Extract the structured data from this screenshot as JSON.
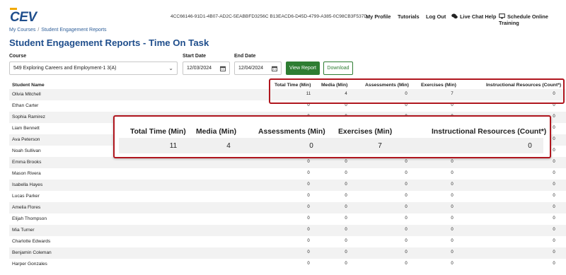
{
  "header": {
    "logo": "CEV",
    "session_id": "4CC66146-91D1-4B07-AD2C-5EABBFD3256C B13EACD6-D45D-4799-A385-0C98CB3F537D",
    "nav": {
      "my_profile": "My Profile",
      "tutorials": "Tutorials",
      "log_out": "Log Out",
      "live_chat": "Live Chat Help",
      "schedule": "Schedule Online Training"
    }
  },
  "breadcrumb": {
    "parent": "My Courses",
    "separator": "/",
    "current": "Student Engagement Reports"
  },
  "page": {
    "title": "Student Engagement Reports - Time On Task"
  },
  "filters": {
    "course_label": "Course",
    "course_value": "549 Exploring Careers and Employment-1 3(A)",
    "start_label": "Start Date",
    "start_value": "12/03/2024",
    "end_label": "End Date",
    "end_value": "12/04/2024",
    "view_report": "View Report",
    "download": "Download"
  },
  "table": {
    "columns": {
      "student": "Student Name",
      "total": "Total Time (Min)",
      "media": "Media (Min)",
      "assessments": "Assessments (Min)",
      "exercises": "Exercises (Min)",
      "resources": "Instructional Resources (Count*)"
    },
    "rows": [
      {
        "name": "Olivia Mitchell",
        "total": "11",
        "media": "4",
        "assessments": "0",
        "exercises": "7",
        "resources": "0"
      },
      {
        "name": "Ethan Carter",
        "total": "0",
        "media": "0",
        "assessments": "0",
        "exercises": "0",
        "resources": "0"
      },
      {
        "name": "Sophia Ramirez",
        "total": "0",
        "media": "0",
        "assessments": "0",
        "exercises": "0",
        "resources": "0"
      },
      {
        "name": "Liam Bennett",
        "total": "0",
        "media": "0",
        "assessments": "0",
        "exercises": "0",
        "resources": "0"
      },
      {
        "name": "Ava Peterson",
        "total": "0",
        "media": "0",
        "assessments": "0",
        "exercises": "0",
        "resources": "0"
      },
      {
        "name": "Noah Sullivan",
        "total": "0",
        "media": "0",
        "assessments": "0",
        "exercises": "0",
        "resources": "0"
      },
      {
        "name": "Emma Brooks",
        "total": "0",
        "media": "0",
        "assessments": "0",
        "exercises": "0",
        "resources": "0"
      },
      {
        "name": "Mason Rivera",
        "total": "0",
        "media": "0",
        "assessments": "0",
        "exercises": "0",
        "resources": "0"
      },
      {
        "name": "Isabella Hayes",
        "total": "0",
        "media": "0",
        "assessments": "0",
        "exercises": "0",
        "resources": "0"
      },
      {
        "name": "Lucas Parker",
        "total": "0",
        "media": "0",
        "assessments": "0",
        "exercises": "0",
        "resources": "0"
      },
      {
        "name": "Amelia Flores",
        "total": "0",
        "media": "0",
        "assessments": "0",
        "exercises": "0",
        "resources": "0"
      },
      {
        "name": "Elijah Thompson",
        "total": "0",
        "media": "0",
        "assessments": "0",
        "exercises": "0",
        "resources": "0"
      },
      {
        "name": "Mia Turner",
        "total": "0",
        "media": "0",
        "assessments": "0",
        "exercises": "0",
        "resources": "0"
      },
      {
        "name": "Charlotte Edwards",
        "total": "0",
        "media": "0",
        "assessments": "0",
        "exercises": "0",
        "resources": "0"
      },
      {
        "name": "Benjamin Coleman",
        "total": "0",
        "media": "0",
        "assessments": "0",
        "exercises": "0",
        "resources": "0"
      },
      {
        "name": "Harper Gonzales",
        "total": "0",
        "media": "0",
        "assessments": "0",
        "exercises": "0",
        "resources": "0"
      }
    ]
  },
  "zoom": {
    "total": "Total Time (Min)",
    "media": "Media (Min)",
    "assessments": "Assessments (Min)",
    "exercises": "Exercises (Min)",
    "resources": "Instructional Resources (Count*)",
    "values": {
      "total": "11",
      "media": "4",
      "assessments": "0",
      "exercises": "7",
      "resources": "0"
    }
  },
  "colors": {
    "brand_blue": "#1f4e8c",
    "button_green": "#2e7d32",
    "highlight_red": "#b0161e"
  },
  "icons": {
    "chat": "chat-bubbles-icon",
    "schedule": "monitor-icon",
    "calendar": "calendar-icon",
    "dropdown": "chevron-down-icon"
  }
}
